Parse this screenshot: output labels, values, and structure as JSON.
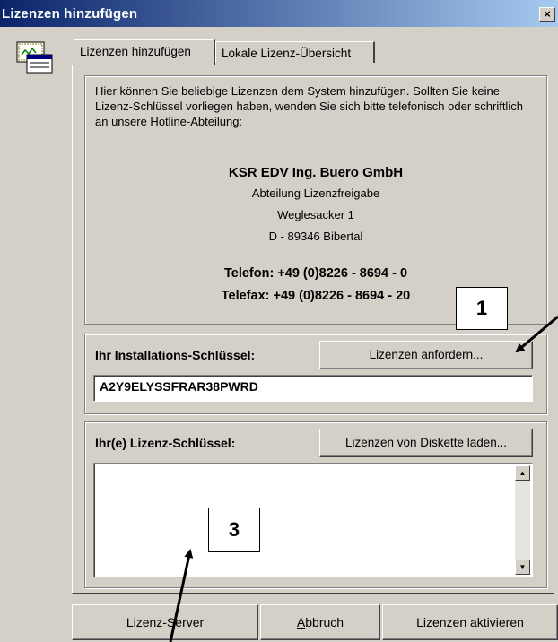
{
  "window": {
    "title": "Lizenzen hinzufügen",
    "close_glyph": "×"
  },
  "tabs": [
    {
      "label": "Lizenzen hinzufügen",
      "active": true
    },
    {
      "label": "Lokale Lizenz-Übersicht",
      "active": false
    }
  ],
  "info": {
    "text": "Hier können Sie beliebige Lizenzen dem System hinzufügen. Sollten Sie keine Lizenz-Schlüssel vorliegen haben, wenden Sie sich bitte telefonisch oder schriftlich an unsere Hotline-Abteilung:",
    "company": "KSR EDV Ing. Buero GmbH",
    "department": "Abteilung Lizenzfreigabe",
    "street": "Weglesacker 1",
    "city": "D - 89346 Bibertal",
    "phone": "Telefon: +49 (0)8226 - 8694 - 0",
    "fax": "Telefax: +49 (0)8226 - 8694 - 20"
  },
  "install_key": {
    "label": "Ihr Installations-Schlüssel:",
    "request_button": "Lizenzen anfordern...",
    "value": "A2Y9ELYSSFRAR38PWRD"
  },
  "license_keys": {
    "label": "Ihr(e) Lizenz-Schlüssel:",
    "load_button": "Lizenzen von Diskette laden...",
    "value": ""
  },
  "callouts": {
    "one": "1",
    "three": "3"
  },
  "buttons": {
    "server": "Lizenz-Server",
    "cancel_ul": "A",
    "cancel_rest": "bbruch",
    "activate": "Lizenzen aktivieren"
  },
  "icons": {
    "app": "license-certificate-icon",
    "scroll_up": "arrow-up-icon",
    "scroll_down": "arrow-down-icon"
  }
}
